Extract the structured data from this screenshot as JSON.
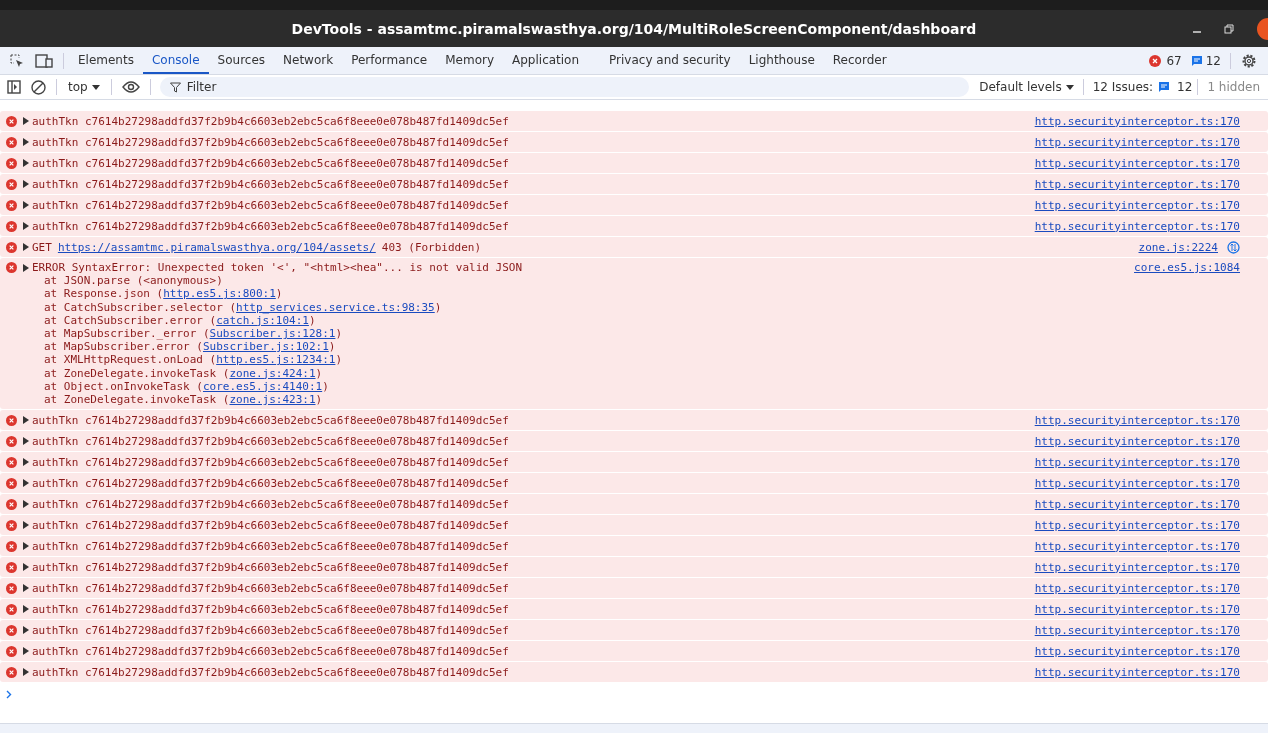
{
  "window": {
    "title": "DevTools - assamtmc.piramalswasthya.org/104/MultiRoleScreenComponent/dashboard"
  },
  "tabs": [
    {
      "label": "Elements",
      "selected": false
    },
    {
      "label": "Console",
      "selected": true
    },
    {
      "label": "Sources",
      "selected": false
    },
    {
      "label": "Network",
      "selected": false
    },
    {
      "label": "Performance",
      "selected": false
    },
    {
      "label": "Memory",
      "selected": false
    },
    {
      "label": "Application",
      "selected": false
    },
    {
      "label": "Privacy and security",
      "selected": false
    },
    {
      "label": "Lighthouse",
      "selected": false
    },
    {
      "label": "Recorder",
      "selected": false
    }
  ],
  "counts": {
    "errors": "67",
    "messages": "12"
  },
  "toolbar": {
    "context": "top",
    "filter": {
      "placeholder": "Filter"
    },
    "levels": "Default levels",
    "issues_label": "12 Issues:",
    "issues_count": "12",
    "hidden": "1 hidden"
  },
  "messages": [
    {
      "kind": "simple",
      "text": "authTkn c7614b27298addfd37f2b9b4c6603eb2ebc5ca6f8eee0e078b487fd1409dc5ef",
      "source": "http.securityinterceptor.ts:170"
    },
    {
      "kind": "simple",
      "text": "authTkn c7614b27298addfd37f2b9b4c6603eb2ebc5ca6f8eee0e078b487fd1409dc5ef",
      "source": "http.securityinterceptor.ts:170"
    },
    {
      "kind": "simple",
      "text": "authTkn c7614b27298addfd37f2b9b4c6603eb2ebc5ca6f8eee0e078b487fd1409dc5ef",
      "source": "http.securityinterceptor.ts:170"
    },
    {
      "kind": "simple",
      "text": "authTkn c7614b27298addfd37f2b9b4c6603eb2ebc5ca6f8eee0e078b487fd1409dc5ef",
      "source": "http.securityinterceptor.ts:170"
    },
    {
      "kind": "simple",
      "text": "authTkn c7614b27298addfd37f2b9b4c6603eb2ebc5ca6f8eee0e078b487fd1409dc5ef",
      "source": "http.securityinterceptor.ts:170"
    },
    {
      "kind": "simple",
      "text": "authTkn c7614b27298addfd37f2b9b4c6603eb2ebc5ca6f8eee0e078b487fd1409dc5ef",
      "source": "http.securityinterceptor.ts:170"
    },
    {
      "kind": "network",
      "method": "GET",
      "url": "https://assamtmc.piramalswasthya.org/104/assets/",
      "status": "403 (Forbidden)",
      "source": "zone.js:2224"
    },
    {
      "kind": "stack",
      "text": "ERROR SyntaxError: Unexpected token '<', \"<html><hea\"... is not valid JSON",
      "source": "core.es5.js:1084",
      "frames": [
        {
          "text": "at JSON.parse (<anonymous>)"
        },
        {
          "text": "at Response.json (",
          "link": "http.es5.js:800:1",
          "tail": ")"
        },
        {
          "text": "at CatchSubscriber.selector (",
          "link": "http_services.service.ts:98:35",
          "tail": ")"
        },
        {
          "text": "at CatchSubscriber.error (",
          "link": "catch.js:104:1",
          "tail": ")"
        },
        {
          "text": "at MapSubscriber._error (",
          "link": "Subscriber.js:128:1",
          "tail": ")"
        },
        {
          "text": "at MapSubscriber.error (",
          "link": "Subscriber.js:102:1",
          "tail": ")"
        },
        {
          "text": "at XMLHttpRequest.onLoad (",
          "link": "http.es5.js:1234:1",
          "tail": ")"
        },
        {
          "text": "at ZoneDelegate.invokeTask (",
          "link": "zone.js:424:1",
          "tail": ")"
        },
        {
          "text": "at Object.onInvokeTask (",
          "link": "core.es5.js:4140:1",
          "tail": ")"
        },
        {
          "text": "at ZoneDelegate.invokeTask (",
          "link": "zone.js:423:1",
          "tail": ")"
        }
      ]
    },
    {
      "kind": "simple",
      "text": "authTkn c7614b27298addfd37f2b9b4c6603eb2ebc5ca6f8eee0e078b487fd1409dc5ef",
      "source": "http.securityinterceptor.ts:170"
    },
    {
      "kind": "simple",
      "text": "authTkn c7614b27298addfd37f2b9b4c6603eb2ebc5ca6f8eee0e078b487fd1409dc5ef",
      "source": "http.securityinterceptor.ts:170"
    },
    {
      "kind": "simple",
      "text": "authTkn c7614b27298addfd37f2b9b4c6603eb2ebc5ca6f8eee0e078b487fd1409dc5ef",
      "source": "http.securityinterceptor.ts:170"
    },
    {
      "kind": "simple",
      "text": "authTkn c7614b27298addfd37f2b9b4c6603eb2ebc5ca6f8eee0e078b487fd1409dc5ef",
      "source": "http.securityinterceptor.ts:170"
    },
    {
      "kind": "simple",
      "text": "authTkn c7614b27298addfd37f2b9b4c6603eb2ebc5ca6f8eee0e078b487fd1409dc5ef",
      "source": "http.securityinterceptor.ts:170"
    },
    {
      "kind": "simple",
      "text": "authTkn c7614b27298addfd37f2b9b4c6603eb2ebc5ca6f8eee0e078b487fd1409dc5ef",
      "source": "http.securityinterceptor.ts:170"
    },
    {
      "kind": "simple",
      "text": "authTkn c7614b27298addfd37f2b9b4c6603eb2ebc5ca6f8eee0e078b487fd1409dc5ef",
      "source": "http.securityinterceptor.ts:170"
    },
    {
      "kind": "simple",
      "text": "authTkn c7614b27298addfd37f2b9b4c6603eb2ebc5ca6f8eee0e078b487fd1409dc5ef",
      "source": "http.securityinterceptor.ts:170"
    },
    {
      "kind": "simple",
      "text": "authTkn c7614b27298addfd37f2b9b4c6603eb2ebc5ca6f8eee0e078b487fd1409dc5ef",
      "source": "http.securityinterceptor.ts:170"
    },
    {
      "kind": "simple",
      "text": "authTkn c7614b27298addfd37f2b9b4c6603eb2ebc5ca6f8eee0e078b487fd1409dc5ef",
      "source": "http.securityinterceptor.ts:170"
    },
    {
      "kind": "simple",
      "text": "authTkn c7614b27298addfd37f2b9b4c6603eb2ebc5ca6f8eee0e078b487fd1409dc5ef",
      "source": "http.securityinterceptor.ts:170"
    },
    {
      "kind": "simple",
      "text": "authTkn c7614b27298addfd37f2b9b4c6603eb2ebc5ca6f8eee0e078b487fd1409dc5ef",
      "source": "http.securityinterceptor.ts:170"
    },
    {
      "kind": "simple",
      "text": "authTkn c7614b27298addfd37f2b9b4c6603eb2ebc5ca6f8eee0e078b487fd1409dc5ef",
      "source": "http.securityinterceptor.ts:170"
    }
  ]
}
